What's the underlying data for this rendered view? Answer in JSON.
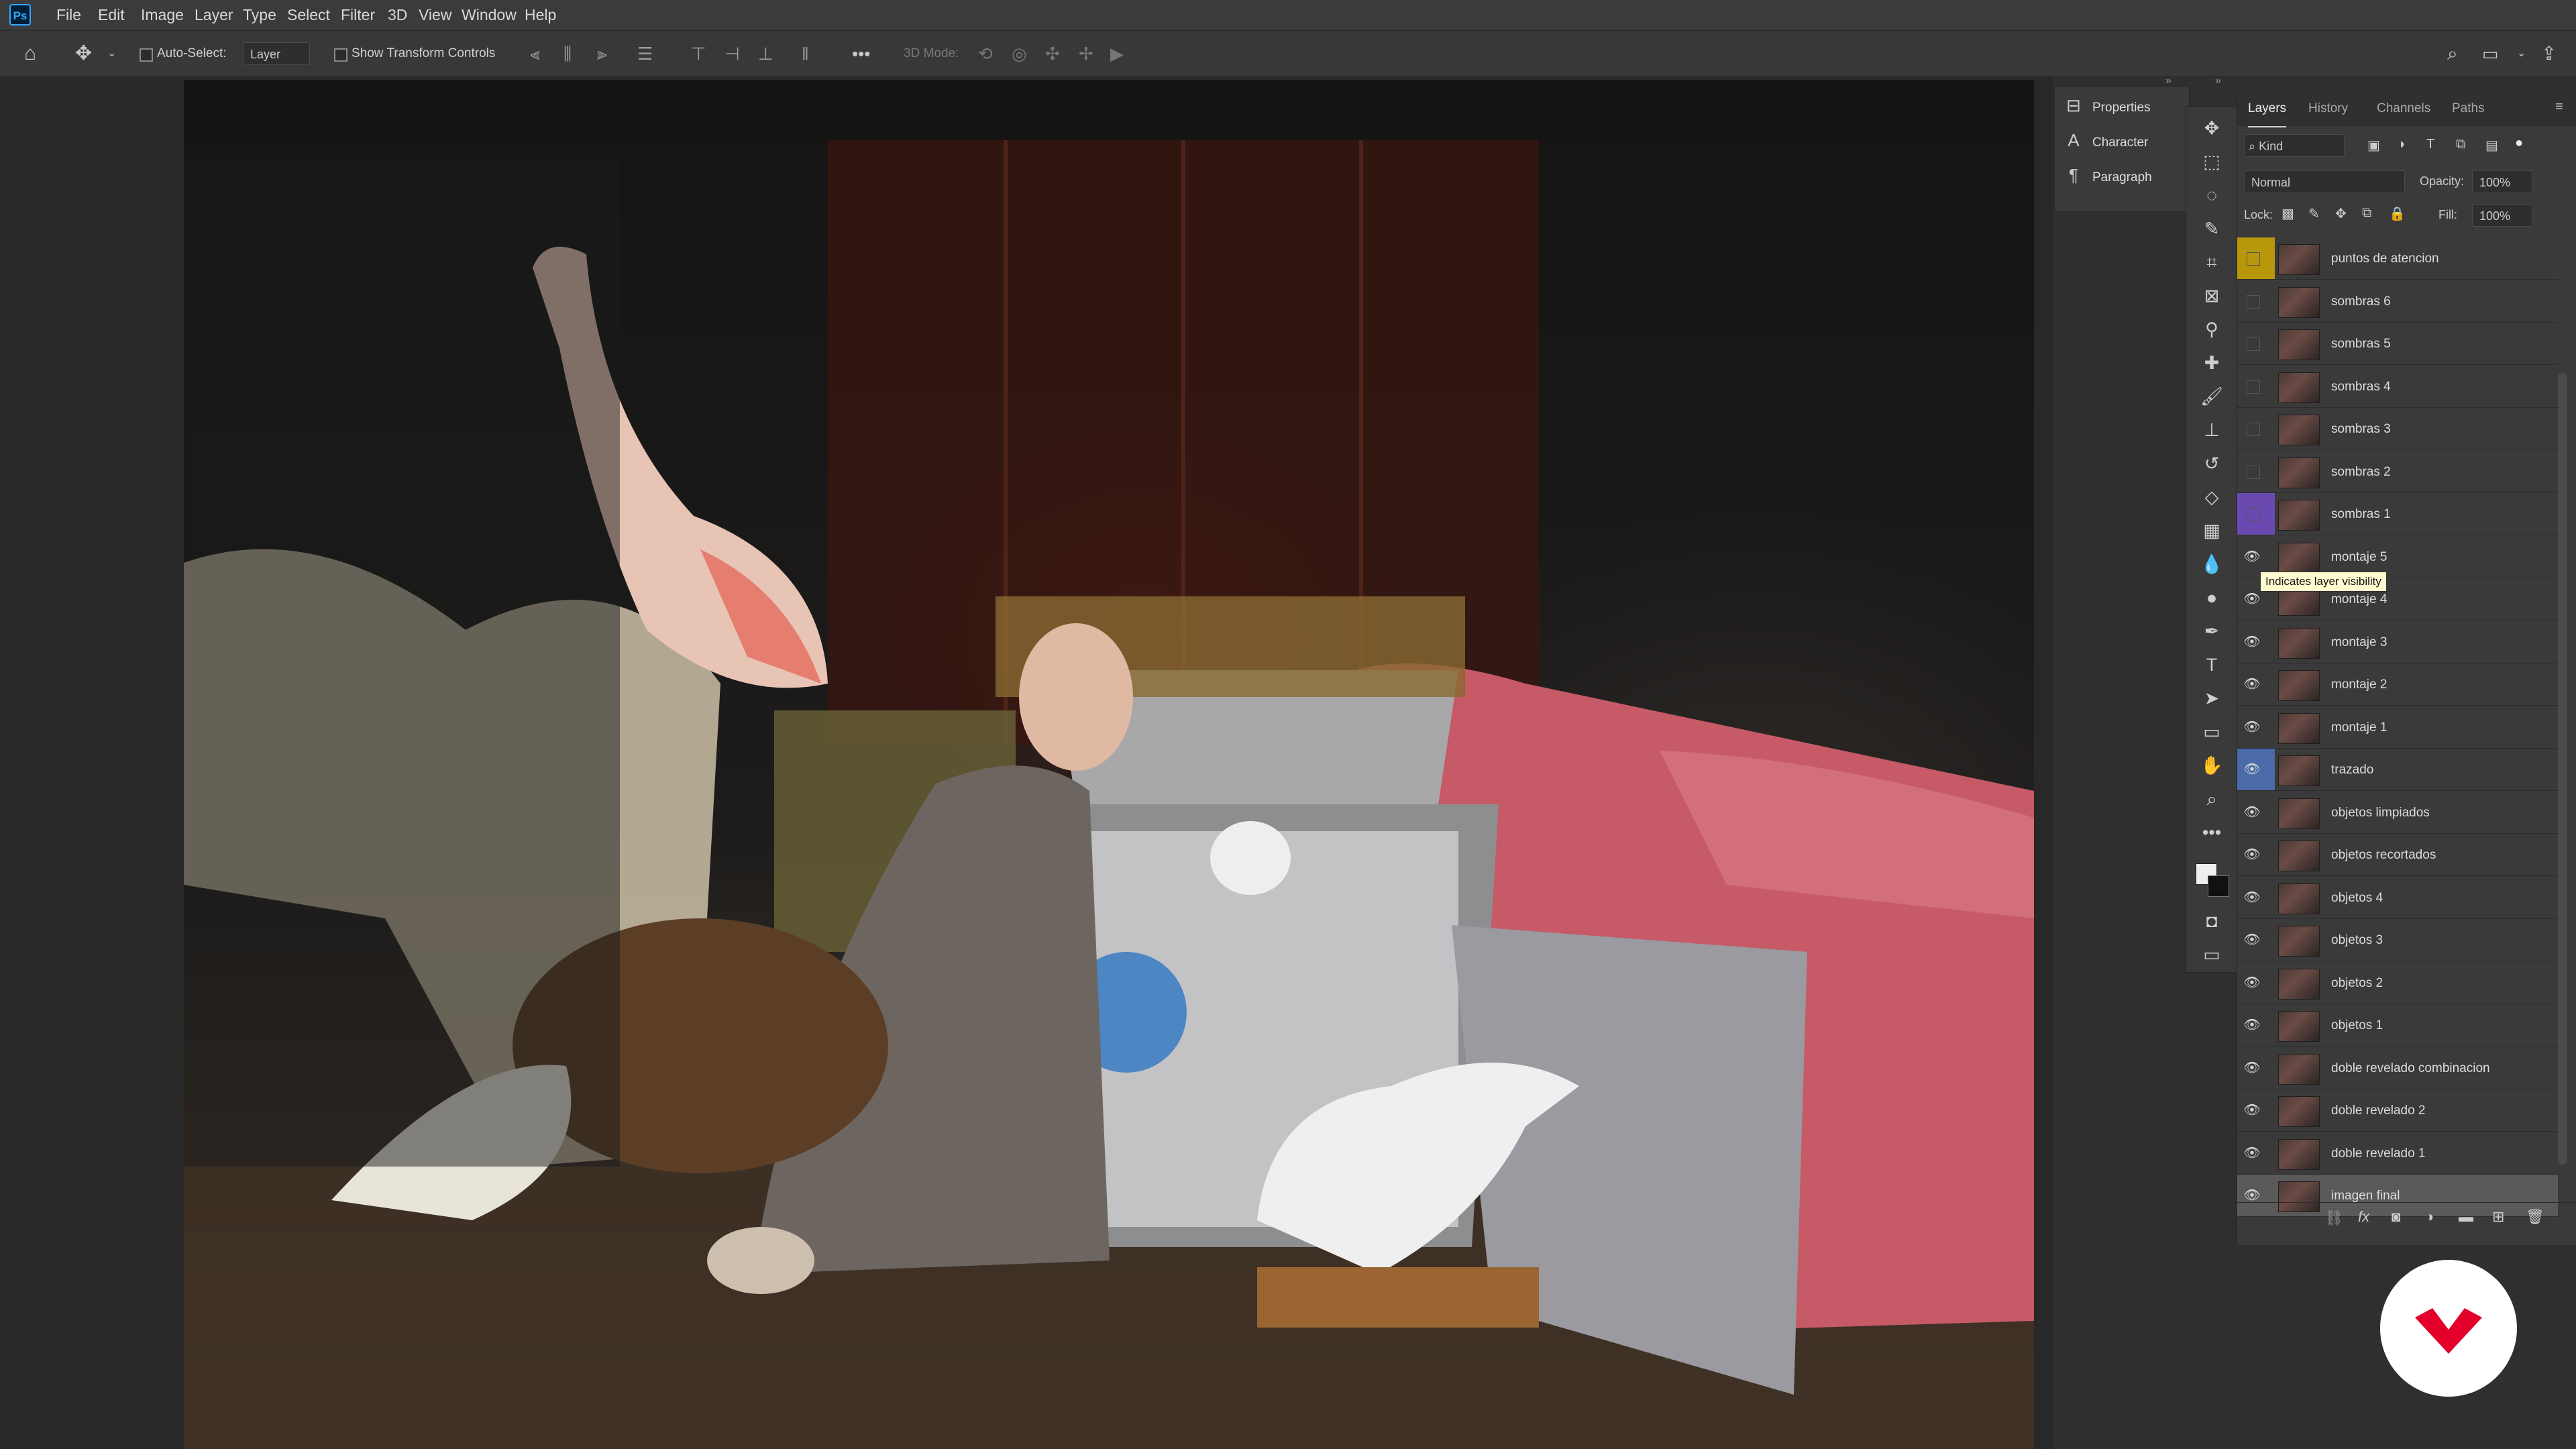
{
  "app": {
    "logo_text": "Ps",
    "accent": "#31a8ff"
  },
  "menu": [
    "File",
    "Edit",
    "Image",
    "Layer",
    "Type",
    "Select",
    "Filter",
    "3D",
    "View",
    "Window",
    "Help"
  ],
  "options_bar": {
    "auto_select_label": "Auto-Select:",
    "auto_select_value": "Layer",
    "show_transform_label": "Show Transform Controls",
    "three_d_mode_label": "3D Mode:"
  },
  "side_panels": [
    {
      "icon": "properties-icon",
      "label": "Properties"
    },
    {
      "icon": "character-icon",
      "label": "Character"
    },
    {
      "icon": "paragraph-icon",
      "label": "Paragraph"
    }
  ],
  "layers_panel": {
    "tabs": [
      "Layers",
      "History",
      "Channels",
      "Paths"
    ],
    "active_tab": "Layers",
    "filter_kind": "Kind",
    "blend_mode": "Normal",
    "opacity_label": "Opacity:",
    "opacity_value": "100%",
    "lock_label": "Lock:",
    "fill_label": "Fill:",
    "fill_value": "100%",
    "tooltip": "Indicates layer visibility",
    "layers": [
      {
        "name": "puntos de atencion",
        "visible": false,
        "color": "#b8980a"
      },
      {
        "name": "sombras 6",
        "visible": false,
        "color": ""
      },
      {
        "name": "sombras 5",
        "visible": false,
        "color": ""
      },
      {
        "name": "sombras 4",
        "visible": false,
        "color": ""
      },
      {
        "name": "sombras 3",
        "visible": false,
        "color": ""
      },
      {
        "name": "sombras 2",
        "visible": false,
        "color": ""
      },
      {
        "name": "sombras 1",
        "visible": false,
        "color": "#6a49b0"
      },
      {
        "name": "montaje 5",
        "visible": true,
        "color": ""
      },
      {
        "name": "montaje 4",
        "visible": true,
        "color": ""
      },
      {
        "name": "montaje 3",
        "visible": true,
        "color": ""
      },
      {
        "name": "montaje 2",
        "visible": true,
        "color": ""
      },
      {
        "name": "montaje 1",
        "visible": true,
        "color": ""
      },
      {
        "name": "trazado",
        "visible": true,
        "color": "#4a6aa8"
      },
      {
        "name": "objetos limpiados",
        "visible": true,
        "color": ""
      },
      {
        "name": "objetos recortados",
        "visible": true,
        "color": ""
      },
      {
        "name": "objetos 4",
        "visible": true,
        "color": ""
      },
      {
        "name": "objetos 3",
        "visible": true,
        "color": ""
      },
      {
        "name": "objetos 2",
        "visible": true,
        "color": ""
      },
      {
        "name": "objetos 1",
        "visible": true,
        "color": ""
      },
      {
        "name": "doble revelado combinacion",
        "visible": true,
        "color": ""
      },
      {
        "name": "doble revelado 2",
        "visible": true,
        "color": ""
      },
      {
        "name": "doble revelado 1",
        "visible": true,
        "color": ""
      },
      {
        "name": "imagen final",
        "visible": true,
        "color": ""
      }
    ],
    "selected_layer": "imagen final"
  },
  "watermark_color": "#e4002b"
}
